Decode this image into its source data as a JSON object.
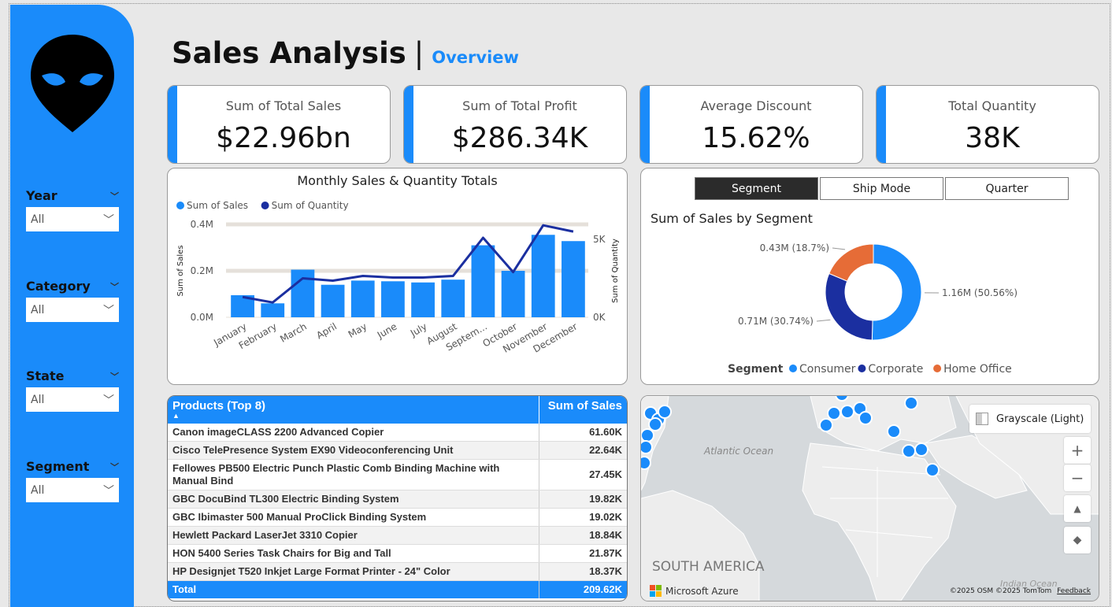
{
  "header": {
    "title": "Sales Analysis",
    "separator": "|",
    "subtitle": "Overview"
  },
  "filters": [
    {
      "label": "Year",
      "value": "All"
    },
    {
      "label": "Category",
      "value": "All"
    },
    {
      "label": "State",
      "value": "All"
    },
    {
      "label": "Segment",
      "value": "All"
    }
  ],
  "kpis": [
    {
      "label": "Sum of Total Sales",
      "value": "$22.96bn"
    },
    {
      "label": "Sum of Total Profit",
      "value": "$286.34K"
    },
    {
      "label": "Average Discount",
      "value": "15.62%"
    },
    {
      "label": "Total Quantity",
      "value": "38K"
    }
  ],
  "monthly": {
    "title": "Monthly Sales & Quantity Totals",
    "legend": [
      "Sum of Sales",
      "Sum of Quantity"
    ],
    "ylabel_left": "Sum of Sales",
    "ylabel_right": "Sum of Quantity"
  },
  "segment": {
    "tabs": [
      "Segment",
      "Ship Mode",
      "Quarter"
    ],
    "active_tab": "Segment",
    "title": "Sum of Sales by Segment",
    "legend_title": "Segment"
  },
  "products": {
    "header": "Products (Top 8)",
    "value_header": "Sum of Sales",
    "rows": [
      {
        "name": "Canon imageCLASS 2200 Advanced Copier",
        "value": "61.60K"
      },
      {
        "name": "Cisco TelePresence System EX90 Videoconferencing Unit",
        "value": "22.64K"
      },
      {
        "name": "Fellowes PB500 Electric Punch Plastic Comb Binding Machine with Manual Bind",
        "value": "27.45K"
      },
      {
        "name": "GBC DocuBind TL300 Electric Binding System",
        "value": "19.82K"
      },
      {
        "name": "GBC Ibimaster 500 Manual ProClick Binding System",
        "value": "19.02K"
      },
      {
        "name": "Hewlett Packard LaserJet 3310 Copier",
        "value": "18.84K"
      },
      {
        "name": "HON 5400 Series Task Chairs for Big and Tall",
        "value": "21.87K"
      },
      {
        "name": "HP Designjet T520 Inkjet Large Format Printer - 24\" Color",
        "value": "18.37K"
      }
    ],
    "total_label": "Total",
    "total_value": "209.62K"
  },
  "map": {
    "style_button": "Grayscale (Light)",
    "ocean_atlantic": "Atlantic Ocean",
    "ocean_indian": "Indian Ocean",
    "continent": "SOUTH AMERICA",
    "brand": "Microsoft Azure",
    "copyright": "©2025 OSM  ©2025 TomTom",
    "feedback": "Feedback",
    "zoom_in": "+",
    "zoom_out": "−"
  },
  "chart_data": [
    {
      "type": "bar",
      "title": "Monthly Sales & Quantity Totals",
      "categories": [
        "January",
        "February",
        "March",
        "April",
        "May",
        "June",
        "July",
        "August",
        "Septem...",
        "October",
        "November",
        "December"
      ],
      "series": [
        {
          "name": "Sum of Sales",
          "type": "bar",
          "axis": "left",
          "values": [
            0.095,
            0.06,
            0.205,
            0.14,
            0.158,
            0.155,
            0.15,
            0.162,
            0.31,
            0.2,
            0.355,
            0.328
          ]
        },
        {
          "name": "Sum of Quantity",
          "type": "line",
          "axis": "right",
          "values": [
            1300,
            950,
            2500,
            2350,
            2650,
            2550,
            2550,
            2650,
            5100,
            2900,
            5900,
            5500
          ]
        }
      ],
      "ylim_left": [
        0,
        0.4
      ],
      "yticks_left": [
        "0.0M",
        "0.2M",
        "0.4M"
      ],
      "ylim_right": [
        0,
        5000
      ],
      "yticks_right": [
        "0K",
        "5K"
      ],
      "xlabel": "",
      "ylabel": "Sum of Sales",
      "ylabel_right": "Sum of Quantity",
      "legend": "top-left",
      "colors": {
        "Sum of Sales": "#1a8bfa",
        "Sum of Quantity": "#1b2fa0"
      }
    },
    {
      "type": "pie",
      "title": "Sum of Sales by Segment",
      "labels": [
        "Consumer",
        "Corporate",
        "Home Office"
      ],
      "values": [
        1.16,
        0.71,
        0.43
      ],
      "percent": [
        50.56,
        30.74,
        18.7
      ],
      "data_labels": [
        "1.16M (50.56%)",
        "0.71M (30.74%)",
        "0.43M (18.7%)"
      ],
      "colors": [
        "#1a8bfa",
        "#1b2fa0",
        "#e66c37"
      ],
      "donut": true,
      "legend": "bottom"
    }
  ]
}
